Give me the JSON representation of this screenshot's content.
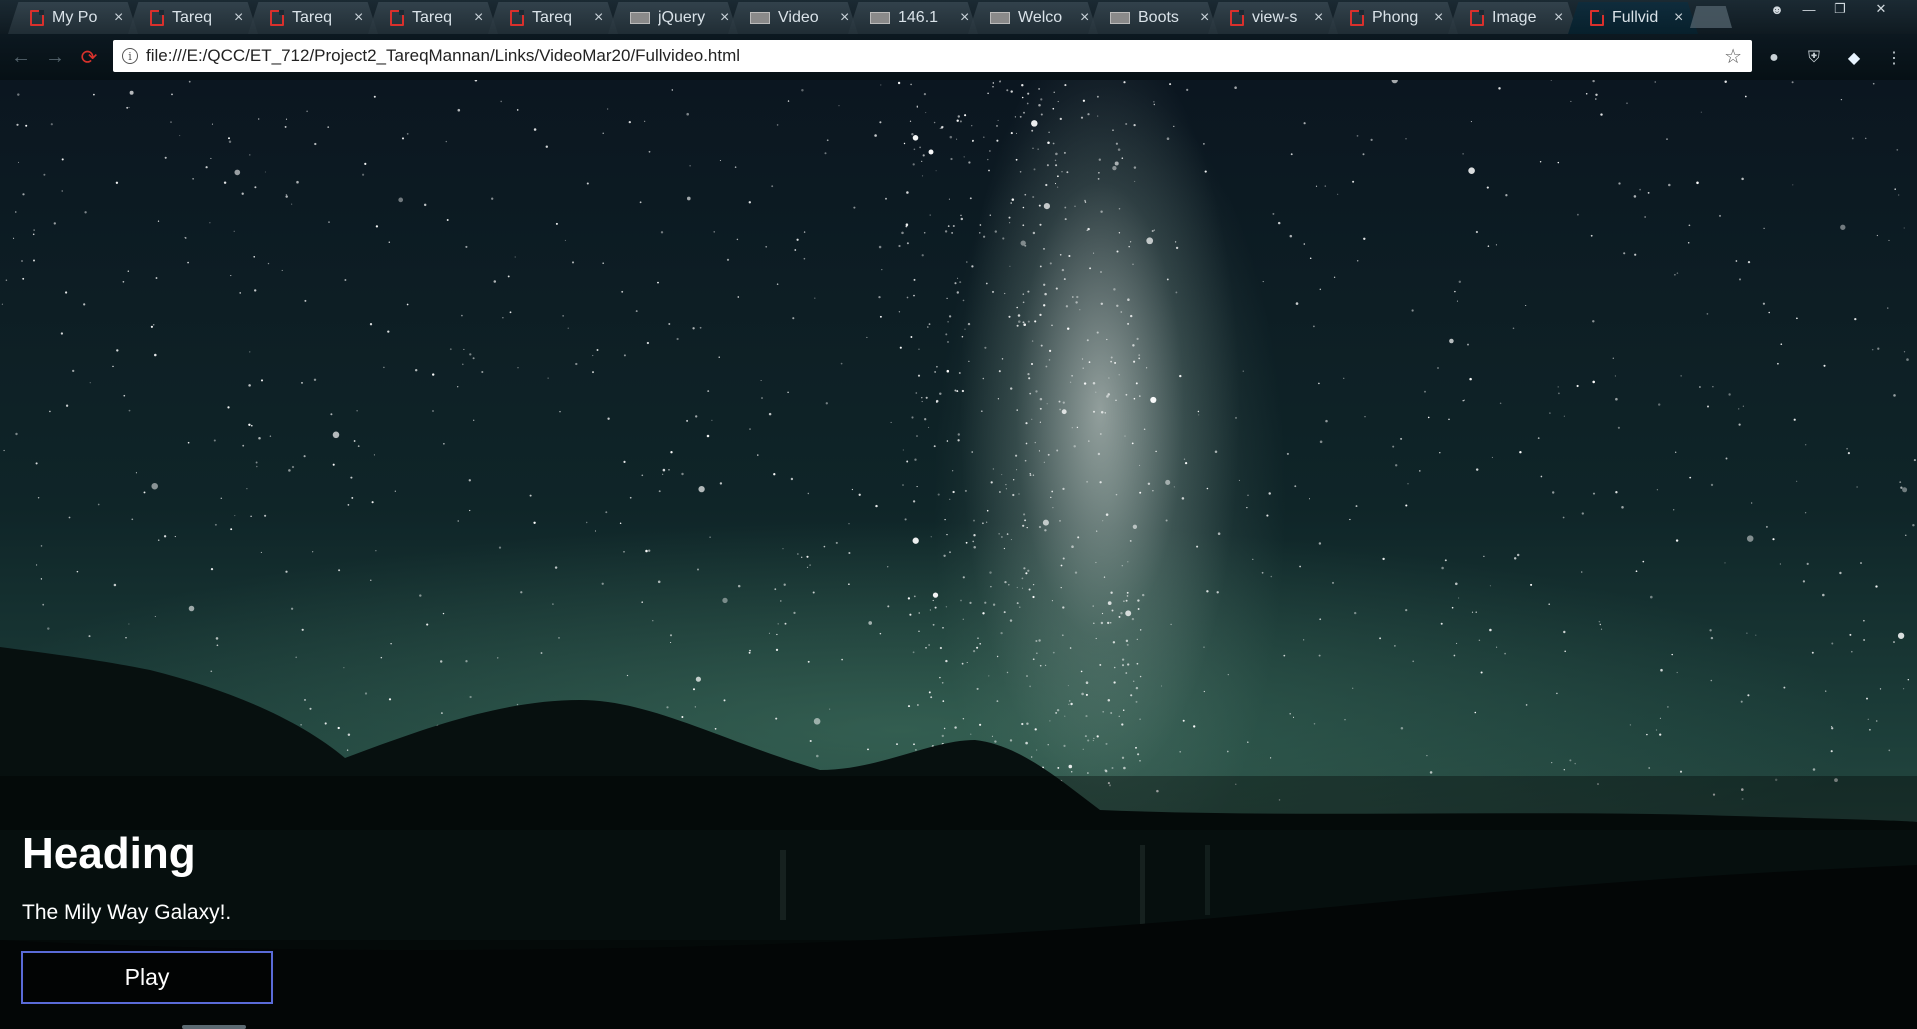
{
  "browser": {
    "tabs": [
      {
        "label": "My Po",
        "icon": "doc-icon",
        "active": false
      },
      {
        "label": "Tareq",
        "icon": "doc-icon",
        "active": false
      },
      {
        "label": "Tareq",
        "icon": "doc-icon",
        "active": false
      },
      {
        "label": "Tareq",
        "icon": "doc-icon",
        "active": false
      },
      {
        "label": "Tareq",
        "icon": "doc-icon",
        "active": false
      },
      {
        "label": "jQuery",
        "icon": "image-icon",
        "active": false
      },
      {
        "label": "Video",
        "icon": "image-icon",
        "active": false
      },
      {
        "label": "146.1",
        "icon": "image-icon",
        "active": false
      },
      {
        "label": "Welco",
        "icon": "image-icon",
        "active": false
      },
      {
        "label": "Boots",
        "icon": "image-icon",
        "active": false
      },
      {
        "label": "view-s",
        "icon": "doc-icon",
        "active": false
      },
      {
        "label": "Phong",
        "icon": "doc-icon",
        "active": false
      },
      {
        "label": "Image",
        "icon": "doc-icon",
        "active": false
      },
      {
        "label": "Fullvid",
        "icon": "doc-icon",
        "active": true
      }
    ],
    "close_glyph": "×",
    "url": "file:///E:/QCC/ET_712/Project2_TareqMannan/Links/VideoMar20/Fullvideo.html"
  },
  "page": {
    "heading": "Heading",
    "subtitle": "The Mily Way Galaxy!.",
    "play_label": "Play"
  },
  "colors": {
    "button_border": "#5a6bd8",
    "reload_icon": "#d8322c",
    "pdf_icon": "#d9302c"
  }
}
